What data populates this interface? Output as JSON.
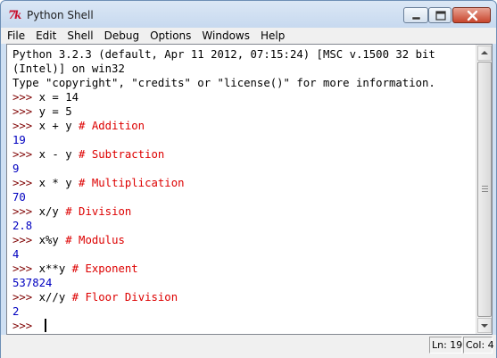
{
  "window": {
    "title": "Python Shell",
    "icon": "python-feather-icon",
    "controls": [
      "minimize-icon",
      "maximize-icon",
      "close-icon"
    ]
  },
  "menu": {
    "items": [
      "File",
      "Edit",
      "Shell",
      "Debug",
      "Options",
      "Windows",
      "Help"
    ]
  },
  "shell": {
    "banner": [
      "Python 3.2.3 (default, Apr 11 2012, 07:15:24) [MSC v.1500 32 bit",
      "(Intel)] on win32",
      "Type \"copyright\", \"credits\" or \"license()\" for more information."
    ],
    "prompt": ">>> ",
    "history": [
      {
        "code": "x = 14",
        "comment": ""
      },
      {
        "code": "y = 5",
        "comment": ""
      },
      {
        "code": "x + y ",
        "comment": "# Addition",
        "result": "19"
      },
      {
        "code": "x - y ",
        "comment": "# Subtraction",
        "result": "9"
      },
      {
        "code": "x * y ",
        "comment": "# Multiplication",
        "result": "70"
      },
      {
        "code": "x/y ",
        "comment": "# Division",
        "result": "2.8"
      },
      {
        "code": "x%y ",
        "comment": "# Modulus",
        "result": "4"
      },
      {
        "code": "x**y ",
        "comment": "# Exponent",
        "result": "537824"
      },
      {
        "code": "x//y ",
        "comment": "# Floor Division",
        "result": "2"
      }
    ],
    "current_prompt": ">>> "
  },
  "status": {
    "line": "Ln: 19",
    "col": "Col: 4"
  },
  "colors": {
    "prompt": "#7f0000",
    "comment": "#dd0000",
    "result": "#0000c0"
  }
}
